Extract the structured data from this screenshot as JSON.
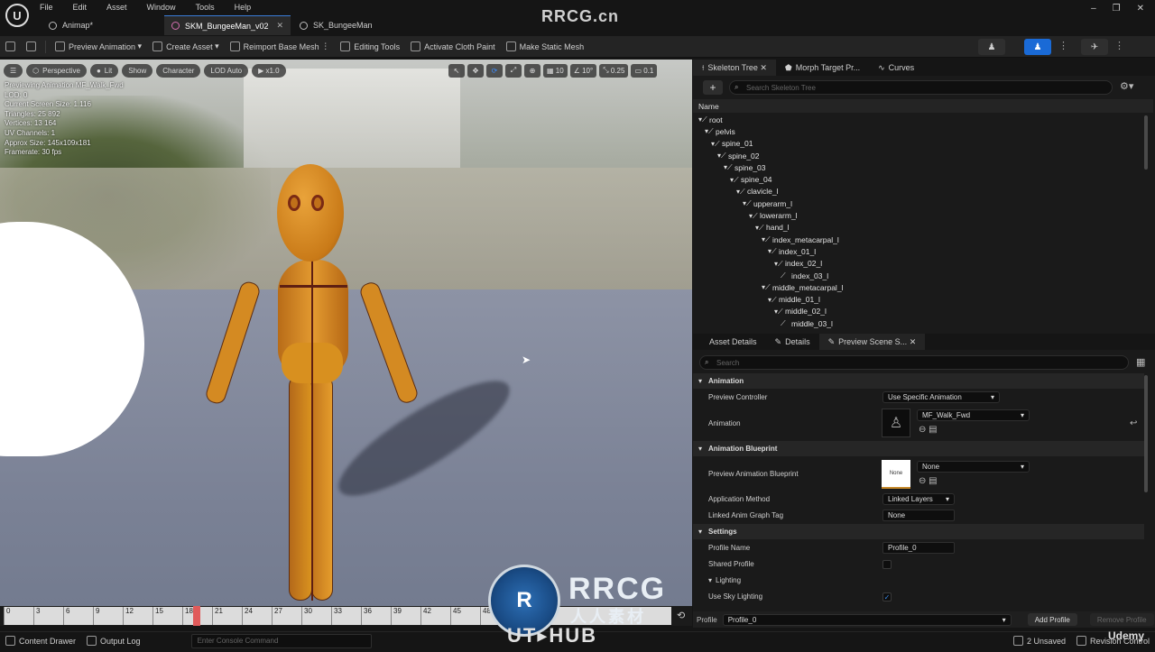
{
  "window": {
    "menu": [
      "File",
      "Edit",
      "Asset",
      "Window",
      "Tools",
      "Help"
    ],
    "tabs": [
      {
        "label": "Animap*"
      },
      {
        "label": "SKM_BungeeMan_v02"
      },
      {
        "label": "SK_BungeeMan"
      }
    ],
    "watermark_top": "RRCG.cn",
    "controls": {
      "min": "–",
      "max": "❐",
      "close": "✕"
    }
  },
  "toolbar": {
    "preview_animation": "Preview Animation",
    "create_asset": "Create Asset",
    "reimport": "Reimport Base Mesh",
    "editing_tools": "Editing Tools",
    "activate_cloth": "Activate Cloth Paint",
    "make_static": "Make Static Mesh"
  },
  "viewport": {
    "menu_icon": "☰",
    "perspective": "Perspective",
    "lit": "Lit",
    "show": "Show",
    "character": "Character",
    "lod": "LOD Auto",
    "speed": "▶ x1.0",
    "grid_size": "10",
    "angle": "10°",
    "scale": "0.25",
    "camera_speed": "0.1",
    "stats": [
      "Previewing Animation MF_Walk_Fwd",
      "LOD: 0",
      "Current Screen Size: 1.116",
      "Triangles: 25 892",
      "Vertices: 13 164",
      "UV Channels: 1",
      "Approx Size: 145x109x181",
      "Framerate: 30 fps"
    ],
    "axis": {
      "z": "Z",
      "x": "X"
    }
  },
  "timeline": {
    "ticks": [
      "0",
      "3",
      "6",
      "9",
      "12",
      "15",
      "18",
      "21",
      "24",
      "27",
      "30",
      "33",
      "36",
      "39",
      "42",
      "45",
      "48",
      "51",
      "54"
    ]
  },
  "skeleton": {
    "tabs": [
      "Skeleton Tree",
      "Morph Target Pr...",
      "Curves"
    ],
    "add": "+",
    "search_placeholder": "Search Skeleton Tree",
    "header": "Name",
    "bones": [
      {
        "name": "root",
        "depth": 0
      },
      {
        "name": "pelvis",
        "depth": 1
      },
      {
        "name": "spine_01",
        "depth": 2
      },
      {
        "name": "spine_02",
        "depth": 3
      },
      {
        "name": "spine_03",
        "depth": 4
      },
      {
        "name": "spine_04",
        "depth": 5
      },
      {
        "name": "clavicle_l",
        "depth": 6
      },
      {
        "name": "upperarm_l",
        "depth": 7
      },
      {
        "name": "lowerarm_l",
        "depth": 8
      },
      {
        "name": "hand_l",
        "depth": 9
      },
      {
        "name": "index_metacarpal_l",
        "depth": 10
      },
      {
        "name": "index_01_l",
        "depth": 11
      },
      {
        "name": "index_02_l",
        "depth": 12
      },
      {
        "name": "index_03_l",
        "depth": 13
      },
      {
        "name": "middle_metacarpal_l",
        "depth": 10
      },
      {
        "name": "middle_01_l",
        "depth": 11
      },
      {
        "name": "middle_02_l",
        "depth": 12
      },
      {
        "name": "middle_03_l",
        "depth": 13
      }
    ]
  },
  "details": {
    "tabs": [
      "Asset Details",
      "Details",
      "Preview Scene S..."
    ],
    "search_placeholder": "Search",
    "animation_cat": "Animation",
    "preview_controller_label": "Preview Controller",
    "preview_controller_value": "Use Specific Animation",
    "animation_label": "Animation",
    "animation_value": "MF_Walk_Fwd",
    "blueprint_cat": "Animation Blueprint",
    "preview_bp_label": "Preview Animation Blueprint",
    "preview_bp_value": "None",
    "preview_bp_thumb": "None",
    "app_method_label": "Application Method",
    "app_method_value": "Linked Layers",
    "graph_tag_label": "Linked Anim Graph Tag",
    "graph_tag_value": "None",
    "settings_cat": "Settings",
    "profile_name_label": "Profile Name",
    "profile_name_value": "Profile_0",
    "shared_profile_label": "Shared Profile",
    "lighting_cat": "Lighting",
    "sky_lighting_label": "Use Sky Lighting",
    "profile_label": "Profile",
    "profile_value": "Profile_0",
    "add_profile": "Add Profile",
    "remove_profile": "Remove Profile"
  },
  "status": {
    "content_drawer": "Content Drawer",
    "output_log": "Output Log",
    "console_placeholder": "Enter Console Command",
    "unsaved": "2 Unsaved",
    "revision": "Revision Control"
  },
  "watermarks": {
    "logo": "R",
    "rrcg": "RRCG",
    "cn": "人人素材",
    "uthub": "UT▸HUB",
    "udemy": "Udemy"
  },
  "colors": {
    "accent": "#3a7dd8",
    "character": "#d1871f",
    "active_mode": "#1a6ad6"
  }
}
